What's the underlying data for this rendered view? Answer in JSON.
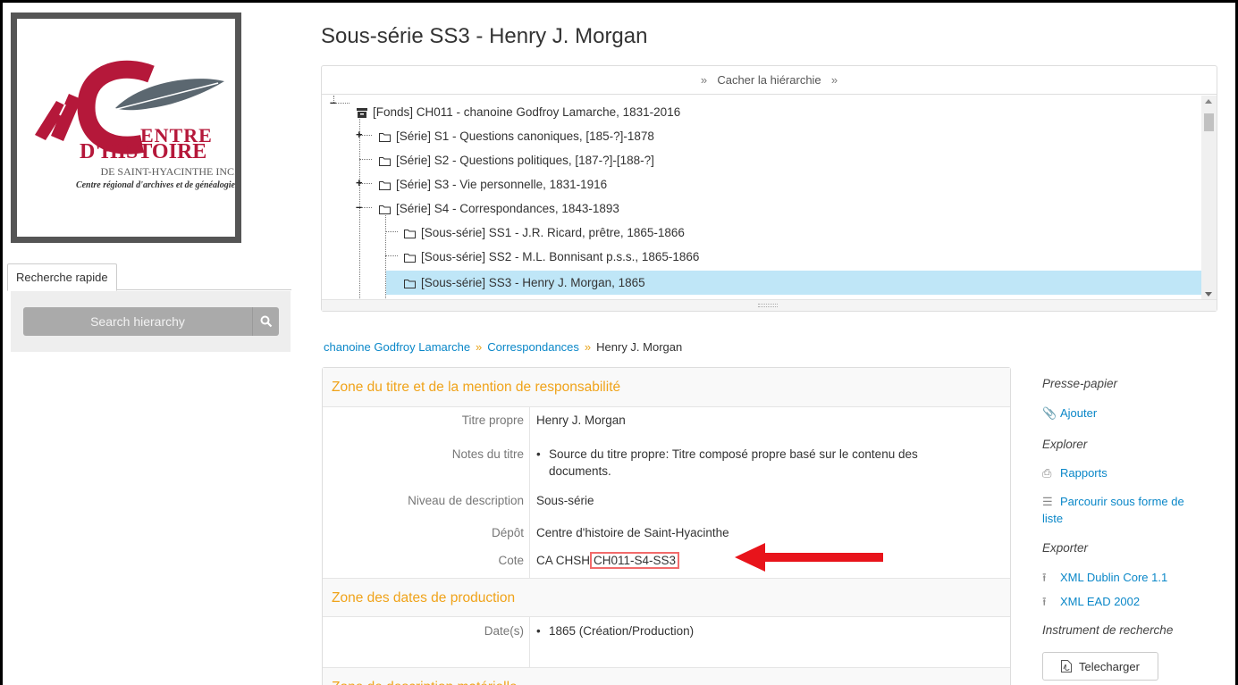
{
  "logo": {
    "line1": "ENTRE",
    "line2": "D'HISTOIRE",
    "line3": "DE SAINT-HYACINTHE INC.",
    "line4": "Centre régional d'archives et de généalogie"
  },
  "sidebar": {
    "tab_label": "Recherche rapide",
    "search_placeholder": "Search hierarchy"
  },
  "page_title": "Sous-série SS3 - Henry J. Morgan",
  "hierarchy": {
    "toggle_label": "Cacher la hiérarchie",
    "items": [
      {
        "label": "[Fonds] CH011 - chanoine Godfroy Lamarche, 1831-2016",
        "icon": "archive-box-icon"
      },
      {
        "label": "[Série] S1 - Questions canoniques, [185-?]-1878",
        "icon": "folder-icon"
      },
      {
        "label": "[Série] S2 - Questions politiques, [187-?]-[188-?]",
        "icon": "folder-icon"
      },
      {
        "label": "[Série] S3 - Vie personnelle, 1831-1916",
        "icon": "folder-icon"
      },
      {
        "label": "[Série] S4 - Correspondances, 1843-1893",
        "icon": "folder-icon"
      },
      {
        "label": "[Sous-série] SS1 - J.R. Ricard, prêtre, 1865-1866",
        "icon": "folder-icon"
      },
      {
        "label": "[Sous-série] SS2 - M.L. Bonnisant p.s.s., 1865-1866",
        "icon": "folder-icon"
      },
      {
        "label": "[Sous-série] SS3 - Henry J. Morgan, 1865",
        "icon": "folder-icon"
      }
    ]
  },
  "breadcrumb": {
    "items": [
      "chanoine Godfroy Lamarche",
      "Correspondances"
    ],
    "current": "Henry J. Morgan"
  },
  "zones": {
    "title_zone": "Zone du titre et de la mention de responsabilité",
    "dates_zone": "Zone des dates de production",
    "next_zone": "Zone de description matérielle"
  },
  "fields": {
    "titre_propre_label": "Titre propre",
    "titre_propre_value": "Henry J. Morgan",
    "notes_label": "Notes du titre",
    "notes_value_1": "Source du titre propre: Titre composé propre basé sur le contenu des",
    "notes_value_2": "documents.",
    "niveau_label": "Niveau de description",
    "niveau_value": "Sous-série",
    "depot_label": "Dépôt",
    "depot_value": "Centre d'histoire de Saint-Hyacinthe",
    "cote_label": "Cote",
    "cote_prefix": "CA CHSH",
    "cote_value": "CH011-S4-SS3",
    "dates_label": "Date(s)",
    "dates_value": "1865 (Création/Production)"
  },
  "right_sidebar": {
    "clipboard_heading": "Presse-papier",
    "add_link": "Ajouter",
    "explore_heading": "Explorer",
    "reports_link": "Rapports",
    "list_link_1": "Parcourir sous forme de",
    "list_link_2": "liste",
    "export_heading": "Exporter",
    "dc_link": "XML Dublin Core 1.1",
    "ead_link": "XML EAD 2002",
    "finding_aid_heading": "Instrument de recherche",
    "download_button": "Telecharger"
  },
  "colors": {
    "link": "#0a87c8",
    "zone_heading": "#f0a31a",
    "selected_row": "#bfe6f7",
    "logo_red": "#b5183a",
    "annotation_arrow": "#e8141b"
  }
}
